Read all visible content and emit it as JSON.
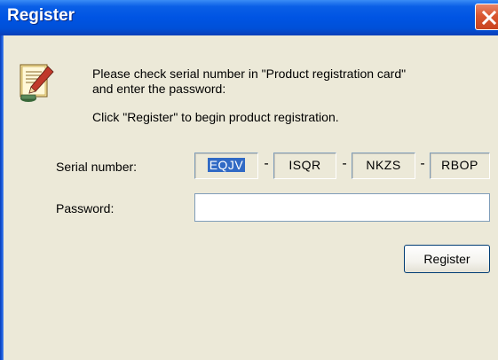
{
  "window": {
    "title": "Register"
  },
  "message": {
    "line1": "Please check serial number in \"Product registration card\"",
    "line2": "and enter the password:",
    "line3": "Click \"Register\" to begin product registration."
  },
  "serial": {
    "label": "Serial number:",
    "separator": "-",
    "parts": [
      "EQJV",
      "ISQR",
      "NKZS",
      "RBOP"
    ]
  },
  "password": {
    "label": "Password:",
    "value": ""
  },
  "actions": {
    "register_label": "Register"
  },
  "icons": {
    "app": "registration-card-pencil-icon",
    "close": "close-icon"
  },
  "colors": {
    "titlebar": "#0054e3",
    "window_bg": "#ece9d8",
    "close_button": "#d9562f",
    "selection": "#316ac5"
  }
}
